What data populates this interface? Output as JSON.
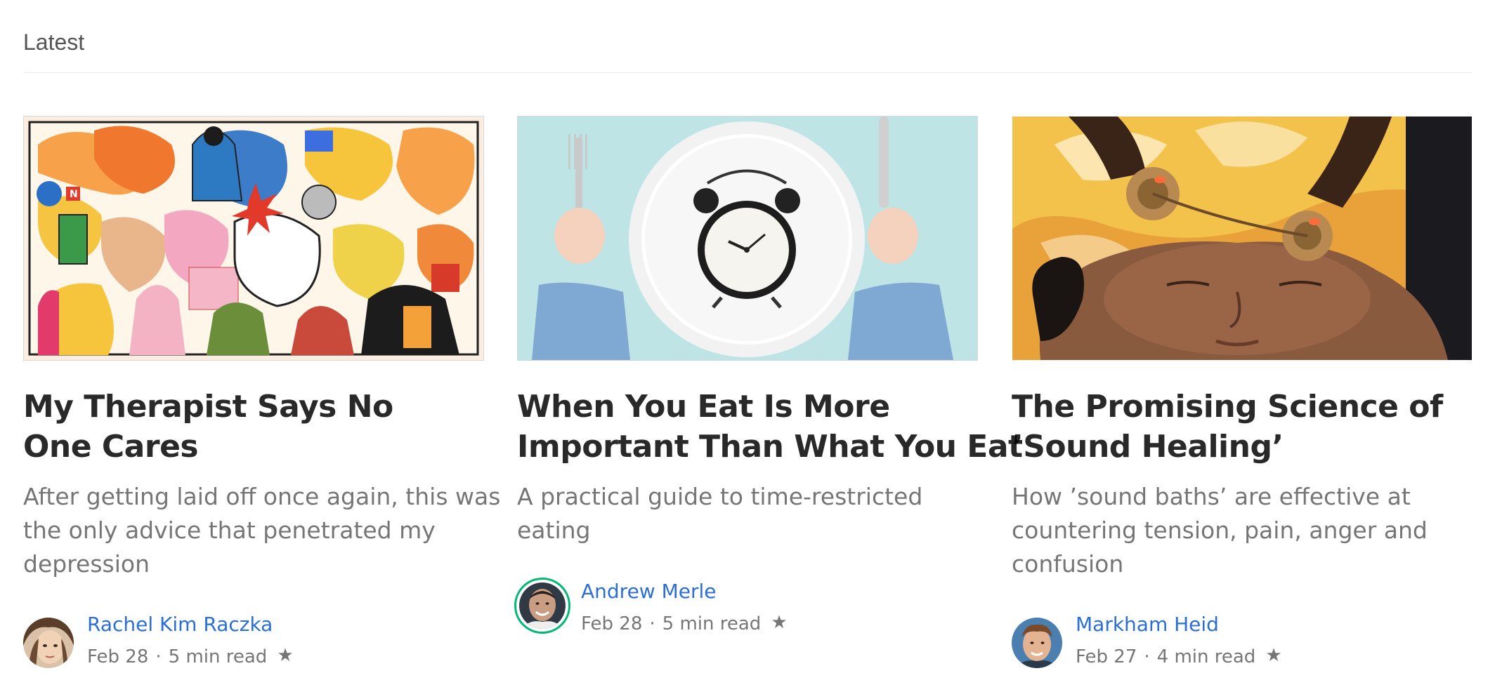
{
  "section": {
    "title": "Latest"
  },
  "cards": [
    {
      "title_lines": [
        "My Therapist Says No",
        "One Cares"
      ],
      "subtitle_lines": [
        "After getting laid off once again, this was",
        "the only advice that penetrated my",
        "depression"
      ],
      "author": "Rachel Kim Raczka",
      "date": "Feb 28",
      "read_time": "5 min read",
      "star_icon": "★"
    },
    {
      "title_lines": [
        "When You Eat Is More",
        "Important Than What You Eat"
      ],
      "subtitle_lines": [
        "A practical guide to time-restricted",
        "eating"
      ],
      "author": "Andrew Merle",
      "date": "Feb 28",
      "read_time": "5 min read",
      "star_icon": "★"
    },
    {
      "title_lines": [
        "The Promising Science of",
        "’Sound Healing’"
      ],
      "subtitle_lines": [
        "How ’sound baths’ are effective at",
        "countering tension, pain, anger and",
        "confusion"
      ],
      "author": "Markham Heid",
      "date": "Feb 27",
      "read_time": "4 min read",
      "star_icon": "★"
    }
  ],
  "colors": {
    "author_link": "#2b6fd6",
    "follow_ring": "#02b875",
    "divider": "#ececec"
  }
}
